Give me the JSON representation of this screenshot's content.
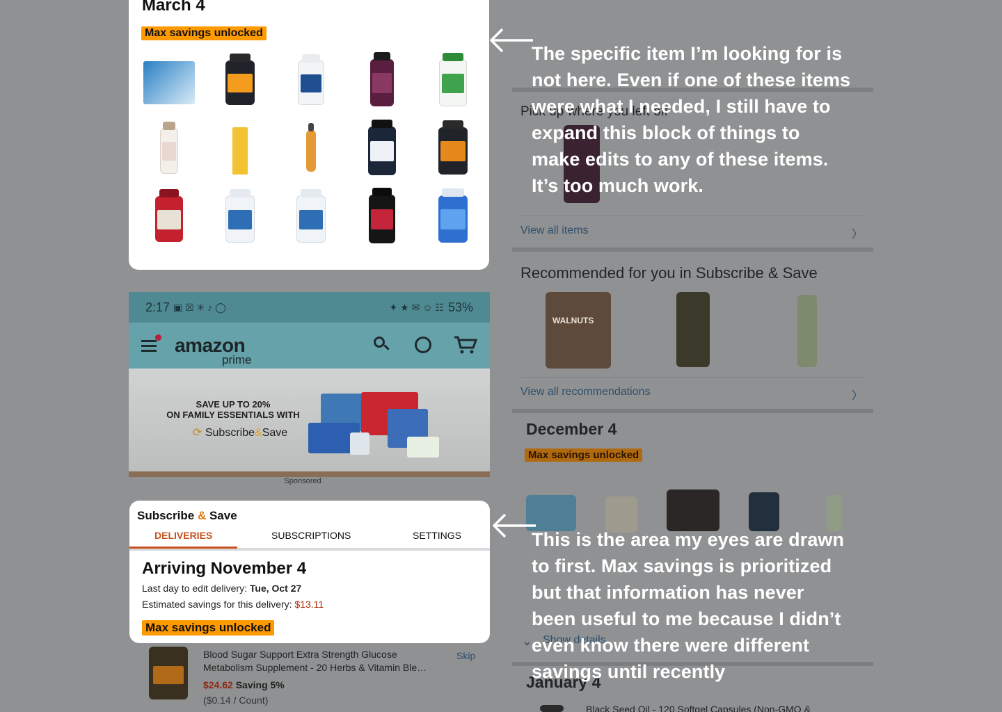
{
  "top_card": {
    "date": "March 4",
    "badge": "Max savings unlocked"
  },
  "background_page": {
    "pickup_heading": "Pick up where you left off",
    "view_all_items": "View all items",
    "recommended_heading": "Recommended for you in Subscribe & Save",
    "view_all_recommendations": "View all recommendations",
    "chevron": "〉",
    "december_date": "December 4",
    "december_badge": "Max savings unlocked",
    "show_details": "Show details",
    "january_date": "January 4",
    "black_seed_item": "Black Seed Oil - 120 Softgel Capsules (Non-GMO &"
  },
  "phone": {
    "time": "2:17",
    "battery": "53%",
    "brand_name": "amazon",
    "brand_sub": "prime",
    "banner_line1": "SAVE UP TO 20%",
    "banner_line2": "ON FAMILY ESSENTIALS WITH",
    "banner_brand_a": "Subscribe",
    "banner_brand_amp": "&",
    "banner_brand_b": "Save",
    "sponsored": "Sponsored"
  },
  "subscribe_card": {
    "title_a": "Subscribe",
    "title_amp": "&",
    "title_b": "Save",
    "tabs": [
      "DELIVERIES",
      "SUBSCRIPTIONS",
      "SETTINGS"
    ],
    "arriving": "Arriving November 4",
    "last_day_label": "Last day to edit delivery:",
    "last_day_value": "Tue, Oct 27",
    "savings_label": "Estimated savings for this delivery:",
    "savings_value": "$13.11",
    "badge": "Max savings unlocked"
  },
  "item_below": {
    "title_line1": "Blood Sugar Support Extra Strength Glucose",
    "title_line2": "Metabolism Supplement - 20 Herbs & Vitamin Ble…",
    "price": "$24.62",
    "saving": "Saving 5%",
    "unit_price": "($0.14 / Count)",
    "skip": "Skip"
  },
  "annotations": {
    "note_top": [
      "The specific item I’m looking for is",
      "not here. Even if one of these items",
      "were what I needed, I still have to",
      "expand this block of things to",
      "make edits to any of these items.",
      "It’s too much work."
    ],
    "note_bottom": [
      "This is the area my eyes are drawn",
      "to first. Max savings is prioritized",
      "but that information has never",
      "been useful to me because I didn’t",
      "even know there were different",
      "savings until recently"
    ]
  },
  "colors": {
    "page_bg": "#8f9193",
    "max_badge": "#ff9900",
    "accent_orange": "#c7511f",
    "status_bar": "#4f8a92",
    "nav_bar": "#66a2a9"
  }
}
